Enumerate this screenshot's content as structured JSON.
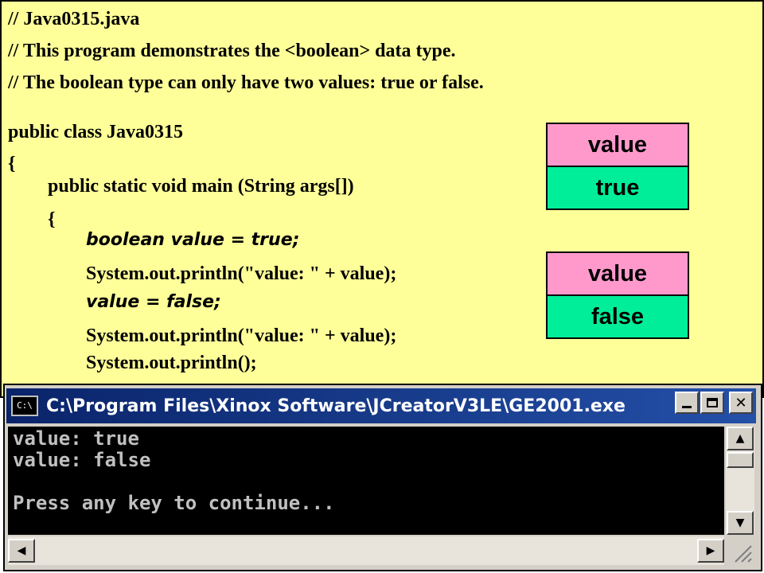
{
  "code": {
    "comment1": "// Java0315.java",
    "comment2": "// This program demonstrates the <boolean> data type.",
    "comment3": "// The boolean type can only have two values: true or false.",
    "class_decl": "public class Java0315",
    "open_brace1": "{",
    "main_decl": "public static void main (String args[])",
    "open_brace2": "{",
    "stmt1": "boolean value = true;",
    "stmt2": "System.out.println(\"value: \" + value);",
    "stmt3": "value = false;",
    "stmt4": "System.out.println(\"value: \" + value);",
    "stmt5": "System.out.println();"
  },
  "memory_boxes": [
    {
      "name": "value",
      "value": "true"
    },
    {
      "name": "value",
      "value": "false"
    }
  ],
  "colors": {
    "code_background": "#ffff99",
    "var_name_fill": "#ff99cc",
    "var_value_fill": "#00ee99",
    "title_bar": "#0a246a"
  },
  "console": {
    "icon_text": "C:\\",
    "title": "C:\\Program Files\\Xinox Software\\JCreatorV3LE\\GE2001.exe",
    "output": "value: true\nvalue: false\n\nPress any key to continue...",
    "controls": [
      "minimize-icon",
      "maximize-icon",
      "close-icon"
    ]
  }
}
